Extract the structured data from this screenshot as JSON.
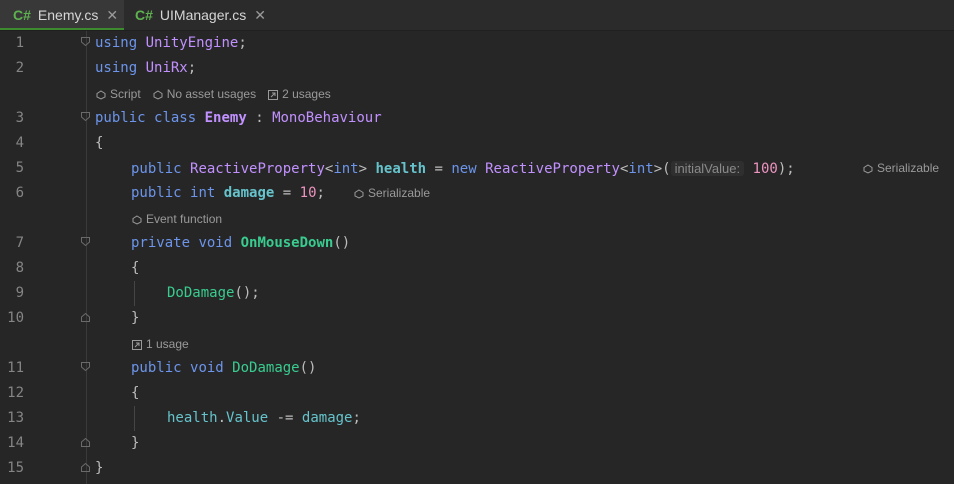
{
  "tabs": [
    {
      "badge": "C#",
      "label": "Enemy.cs",
      "close": "✕"
    },
    {
      "badge": "C#",
      "label": "UIManager.cs",
      "close": "✕"
    }
  ],
  "lines": {
    "l1": {
      "num": "1",
      "kw": "using",
      "name": "UnityEngine",
      "end": ";"
    },
    "l2": {
      "num": "2",
      "kw": "using",
      "name": "UniRx",
      "end": ";"
    },
    "lens1": {
      "script": "Script",
      "assets": "No asset usages",
      "usages": "2 usages"
    },
    "l3": {
      "num": "3",
      "kw1": "public",
      "kw2": "class",
      "cls": "Enemy",
      "colon": ":",
      "base": "MonoBehaviour"
    },
    "l4": {
      "num": "4",
      "text": "{"
    },
    "l5": {
      "num": "5",
      "kw": "public",
      "type": "ReactiveProperty",
      "lt": "<",
      "gen": "int",
      "gt": ">",
      "field": "health",
      "eq": "=",
      "new": "new",
      "type2": "ReactiveProperty",
      "lt2": "<",
      "gen2": "int",
      "gt2": ">(",
      "hint": "initialValue:",
      "val": "100",
      "end": ");",
      "lens": "Serializable"
    },
    "l6": {
      "num": "6",
      "kw": "public",
      "type": "int",
      "field": "damage",
      "eq": "=",
      "val": "10",
      "end": ";",
      "lens": "Serializable"
    },
    "lens2": {
      "text": "Event function"
    },
    "l7": {
      "num": "7",
      "kw1": "private",
      "kw2": "void",
      "fn": "OnMouseDown",
      "end": "()"
    },
    "l8": {
      "num": "8",
      "text": "{"
    },
    "l9": {
      "num": "9",
      "fn": "DoDamage",
      "end": "();"
    },
    "l10": {
      "num": "10",
      "text": "}"
    },
    "lens3": {
      "text": "1 usage"
    },
    "l11": {
      "num": "11",
      "kw1": "public",
      "kw2": "void",
      "fn": "DoDamage",
      "end": "()"
    },
    "l12": {
      "num": "12",
      "text": "{"
    },
    "l13": {
      "num": "13",
      "obj": "health",
      "dot": ".",
      "prop": "Value",
      "op": "-=",
      "var": "damage",
      "end": ";"
    },
    "l14": {
      "num": "14",
      "text": "}"
    },
    "l15": {
      "num": "15",
      "text": "}"
    }
  },
  "colors": {
    "keyword": "#6c95eb",
    "type": "#c191ff",
    "field": "#66c3cc",
    "method": "#39cc8f",
    "number": "#ed94c0",
    "tab_accent": "#3d8b2e"
  }
}
